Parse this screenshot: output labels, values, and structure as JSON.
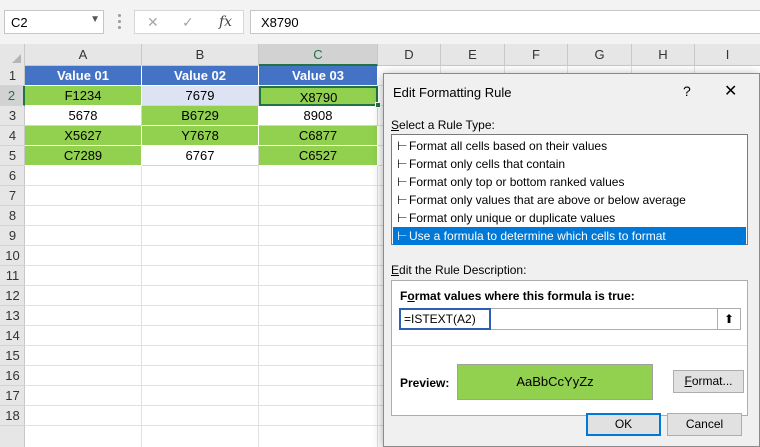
{
  "formula_bar": {
    "name_box": "C2",
    "cancel_glyph": "✕",
    "enter_glyph": "✓",
    "fx_glyph": "fx",
    "formula": "X8790"
  },
  "columns": [
    "A",
    "B",
    "C",
    "D",
    "E",
    "F",
    "G",
    "H",
    "I"
  ],
  "rows": [
    "1",
    "2",
    "3",
    "4",
    "5",
    "6",
    "7",
    "8",
    "9",
    "10",
    "11",
    "12",
    "13",
    "14",
    "15",
    "16",
    "17",
    "18"
  ],
  "table": {
    "headers": [
      "Value 01",
      "Value 02",
      "Value 03"
    ],
    "rows": [
      [
        "F1234",
        "7679",
        "X8790"
      ],
      [
        "5678",
        "B6729",
        "8908"
      ],
      [
        "X5627",
        "Y7678",
        "C6877"
      ],
      [
        "C7289",
        "6767",
        "C6527"
      ]
    ]
  },
  "colors": {
    "header_fill": "#4472c4",
    "highlight_fill": "#92d050",
    "selection": "#217346",
    "list_selection": "#0078d7"
  },
  "dialog": {
    "title": "Edit Formatting Rule",
    "help": "?",
    "close": "✕",
    "select_rule_type_pre": "",
    "select_rule_type_key": "S",
    "select_rule_type_post": "elect a Rule Type:",
    "rule_types": [
      "Format all cells based on their values",
      "Format only cells that contain",
      "Format only top or bottom ranked values",
      "Format only values that are above or below average",
      "Format only unique or duplicate values",
      "Use a formula to determine which cells to format"
    ],
    "rule_type_arrow": "⊢",
    "selected_rule_index": 5,
    "edit_desc_pre": "",
    "edit_desc_key": "E",
    "edit_desc_post": "dit the Rule Description:",
    "formula_label_pre": "F",
    "formula_label_key": "o",
    "formula_label_post": "rmat values where this formula is true:",
    "formula_value": "=ISTEXT(A2)",
    "collapse_glyph": "⬆",
    "preview_label": "Preview:",
    "preview_sample": "AaBbCcYyZz",
    "format_btn_key": "F",
    "format_btn_post": "ormat...",
    "ok": "OK",
    "cancel": "Cancel"
  }
}
